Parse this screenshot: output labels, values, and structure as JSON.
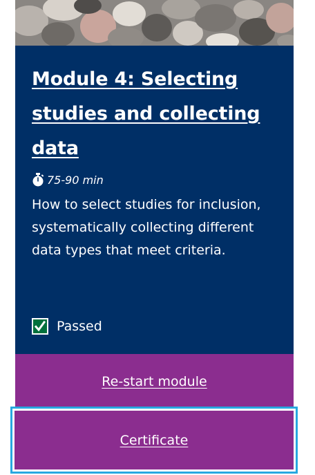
{
  "module": {
    "title": "Module 4: Selecting studies and collecting data",
    "duration": "75-90 min",
    "description": "How to select studies for inclusion, systematically collecting different data types that meet criteria.",
    "status": "Passed"
  },
  "actions": {
    "restart_label": "Re-start module",
    "certificate_label": "Certificate"
  },
  "icons": {
    "duration": "stopwatch-icon",
    "status": "checkbox-checked-icon"
  },
  "colors": {
    "panel": "#002f66",
    "action": "#8b2d8f",
    "focus": "#28a8e0",
    "check": "#00703c"
  }
}
